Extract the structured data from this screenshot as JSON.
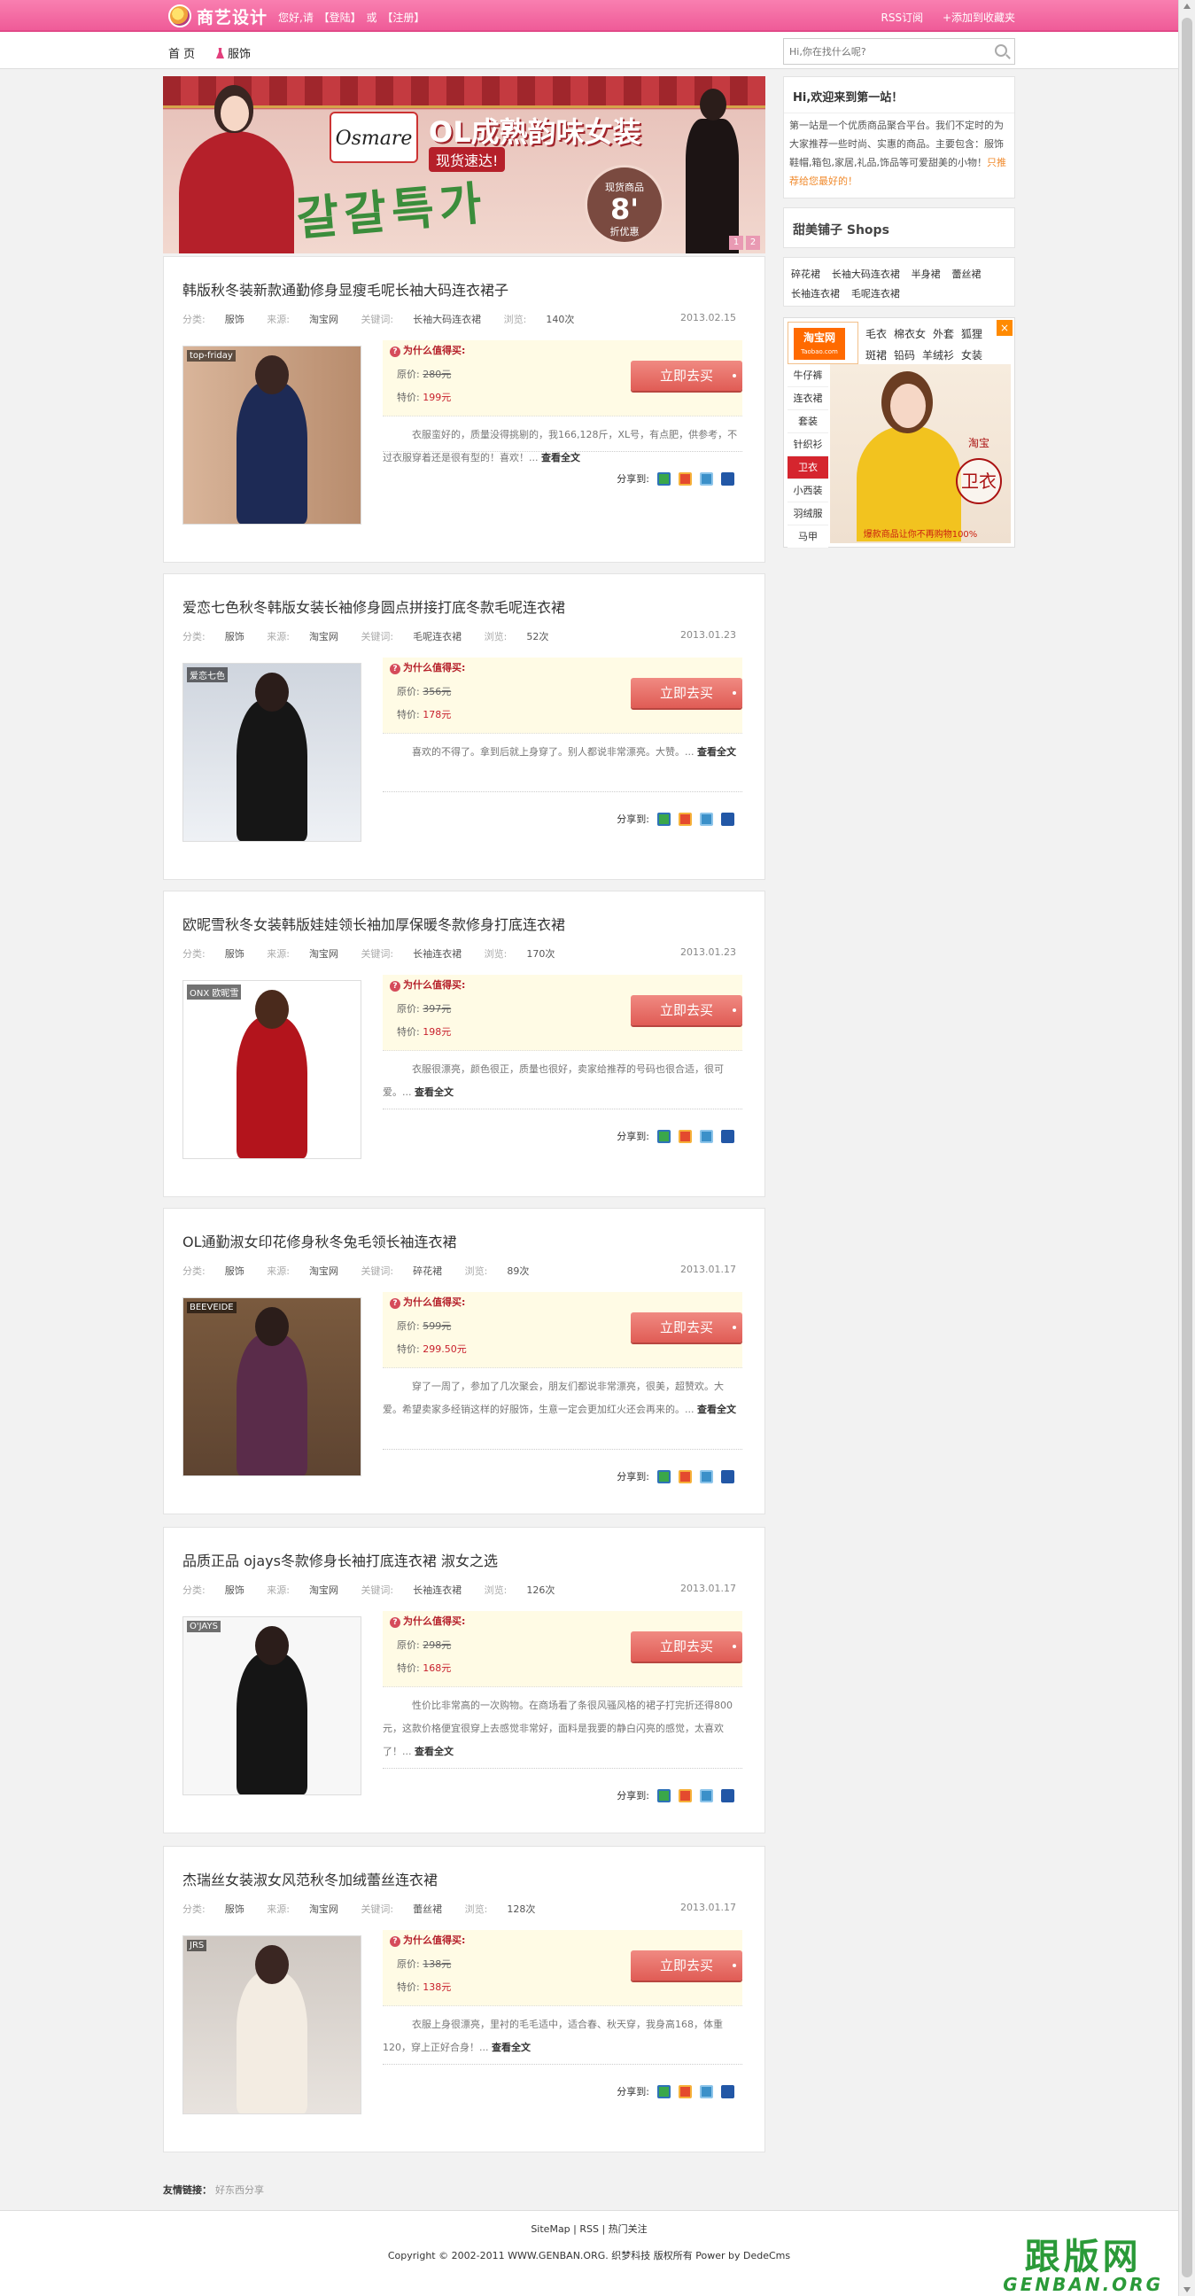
{
  "header": {
    "logo_text": "商艺设计",
    "welcome": "您好,请",
    "login": "【登陆】",
    "or": "或",
    "register": "【注册】",
    "rss": "RSS订阅",
    "favorite": "+添加到收藏夹"
  },
  "nav": {
    "home": "首 页",
    "clothing": "服饰"
  },
  "search": {
    "placeholder": "Hi,你在找什么呢?"
  },
  "banner": {
    "logo_text": "Osmare",
    "title": "OL成熟韵味女装",
    "subtitle": "现货速达!",
    "script_text": "갈갈특가",
    "badge_top": "现货商品",
    "badge_value": "8'",
    "badge_bottom": "折优惠",
    "dots": [
      "1",
      "2"
    ]
  },
  "labels": {
    "category": "分类:",
    "source": "来源:",
    "keywords": "关键词:",
    "views": "浏览:",
    "why": "为什么值得买:",
    "original_price": "原价:",
    "sale_price": "特价:",
    "buy": "立即去买",
    "read_more": "查看全文",
    "share": "分享到:"
  },
  "posts": [
    {
      "title": "韩版秋冬装新款通勤修身显瘦毛呢长袖大码连衣裙子",
      "category": "服饰",
      "source": "淘宝网",
      "keyword": "长袖大码连衣裙",
      "views": "140次",
      "date": "2013.02.15",
      "thumb_label": "top-friday",
      "original_price": "280元",
      "sale_price": "199元",
      "desc": "衣服蛮好的，质量没得挑剔的，我166,128斤，XL号，有点肥，供参考，不过衣服穿着还是很有型的！喜欢！..."
    },
    {
      "title": "爱恋七色秋冬韩版女装长袖修身圆点拼接打底冬款毛呢连衣裙",
      "category": "服饰",
      "source": "淘宝网",
      "keyword": "毛呢连衣裙",
      "views": "52次",
      "date": "2013.01.23",
      "thumb_label": "爱恋七色",
      "original_price": "356元",
      "sale_price": "178元",
      "desc": "喜欢的不得了。拿到后就上身穿了。别人都说非常漂亮。大赞。..."
    },
    {
      "title": "欧昵雪秋冬女装韩版娃娃领长袖加厚保暖冬款修身打底连衣裙",
      "category": "服饰",
      "source": "淘宝网",
      "keyword": "长袖连衣裙",
      "views": "170次",
      "date": "2013.01.23",
      "thumb_label": "ONX 欧昵雪",
      "original_price": "397元",
      "sale_price": "198元",
      "desc": "衣服很漂亮，颜色很正，质量也很好，卖家给推荐的号码也很合适，很可爱。..."
    },
    {
      "title": "OL通勤淑女印花修身秋冬兔毛领长袖连衣裙",
      "category": "服饰",
      "source": "淘宝网",
      "keyword": "碎花裙",
      "views": "89次",
      "date": "2013.01.17",
      "thumb_label": "BEEVEIDE",
      "original_price": "599元",
      "sale_price": "299.50元",
      "desc": "穿了一周了，参加了几次聚会，朋友们都说非常漂亮，很美，超赞欢。大爱。希望卖家多经销这样的好服饰，生意一定会更加红火还会再来的。..."
    },
    {
      "title": "品质正品 ojays冬款修身长袖打底连衣裙 淑女之选",
      "category": "服饰",
      "source": "淘宝网",
      "keyword": "长袖连衣裙",
      "views": "126次",
      "date": "2013.01.17",
      "thumb_label": "O'JAYS",
      "original_price": "298元",
      "sale_price": "168元",
      "desc": "性价比非常高的一次购物。在商场看了条很风骚风格的裙子打完折还得800元，这款价格便宜很穿上去感觉非常好，面料是我要的静白闪亮的感觉，太喜欢了！..."
    },
    {
      "title": "杰瑞丝女装淑女风范秋冬加绒蕾丝连衣裙",
      "category": "服饰",
      "source": "淘宝网",
      "keyword": "蕾丝裙",
      "views": "128次",
      "date": "2013.01.17",
      "thumb_label": "JRS",
      "original_price": "138元",
      "sale_price": "138元",
      "desc": "衣服上身很漂亮，里衬的毛毛适中，适合春、秋天穿，我身高168，体重120，穿上正好合身！..."
    }
  ],
  "sidebar": {
    "welcome_title": "Hi,欢迎来到第一站！",
    "welcome_text": "第一站是一个优质商品聚合平台。我们不定时的为大家推荐一些时尚、实惠的商品。主要包含：服饰鞋帽,箱包,家居,礼品,饰品等可爱甜美的小物！",
    "welcome_link": "只推荐给您最好的！",
    "shops_title": "甜美铺子 Shops",
    "tags": [
      "碎花裙",
      "长袖大码连衣裙",
      "半身裙",
      "蕾丝裙",
      "长袖连衣裙",
      "毛呢连衣裙"
    ],
    "ad": {
      "logo": "淘宝网",
      "logo_sub": "Taobao.com",
      "categories": [
        "毛衣",
        "棉衣女",
        "外套",
        "狐狸",
        "斑裙",
        "铅码",
        "羊绒衫",
        "女装"
      ],
      "menu": [
        "牛仔裤",
        "连衣裙",
        "套装",
        "针织衫",
        "卫衣",
        "小西装",
        "羽绒服",
        "马甲"
      ],
      "active_menu": "卫衣",
      "img_brand": "淘宝",
      "img_title": "卫衣",
      "img_footer": "爆款商品让你不再购物100%",
      "close": "×"
    }
  },
  "footer": {
    "friend_label": "友情链接：",
    "friend_link": "好东西分享",
    "links": "SiteMap | RSS | 热门关注",
    "copyright": "Copyright © 2002-2011 WWW.GENBAN.ORG. 织梦科技 版权所有 Power by DedeCms",
    "watermark_cn": "跟版网",
    "watermark_en": "GENBAN.ORG"
  }
}
